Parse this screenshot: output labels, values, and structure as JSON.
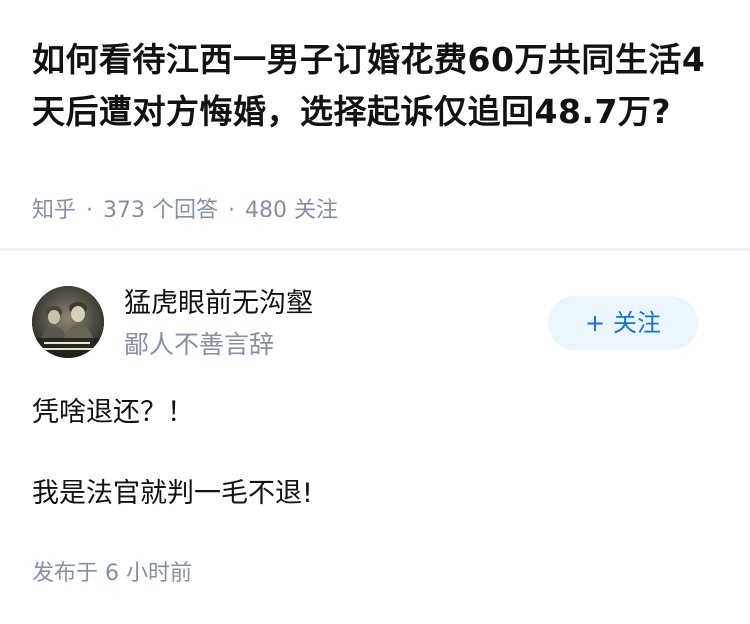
{
  "question": {
    "title": "如何看待江西一男子订婚花费60万共同生活4天后遭对方悔婚，选择起诉仅追回48.7万?",
    "source": "知乎",
    "separator": "·",
    "answer_count": "373 个回答",
    "follower_count": "480 关注"
  },
  "answer": {
    "author": {
      "name": "猛虎眼前无沟壑",
      "bio": "鄙人不善言辞",
      "avatar_icon": "portrait-avatar-icon"
    },
    "follow_button": {
      "icon": "+",
      "label": "关注"
    },
    "content": [
      "凭啥退还？！",
      "我是法官就判一毛不退!"
    ],
    "published": "发布于 6 小时前"
  },
  "colors": {
    "text_primary": "#121212",
    "text_secondary": "#8590a6",
    "follow_bg": "#ebf5fd",
    "follow_text": "#1772d2",
    "divider": "#f3f3f5"
  }
}
